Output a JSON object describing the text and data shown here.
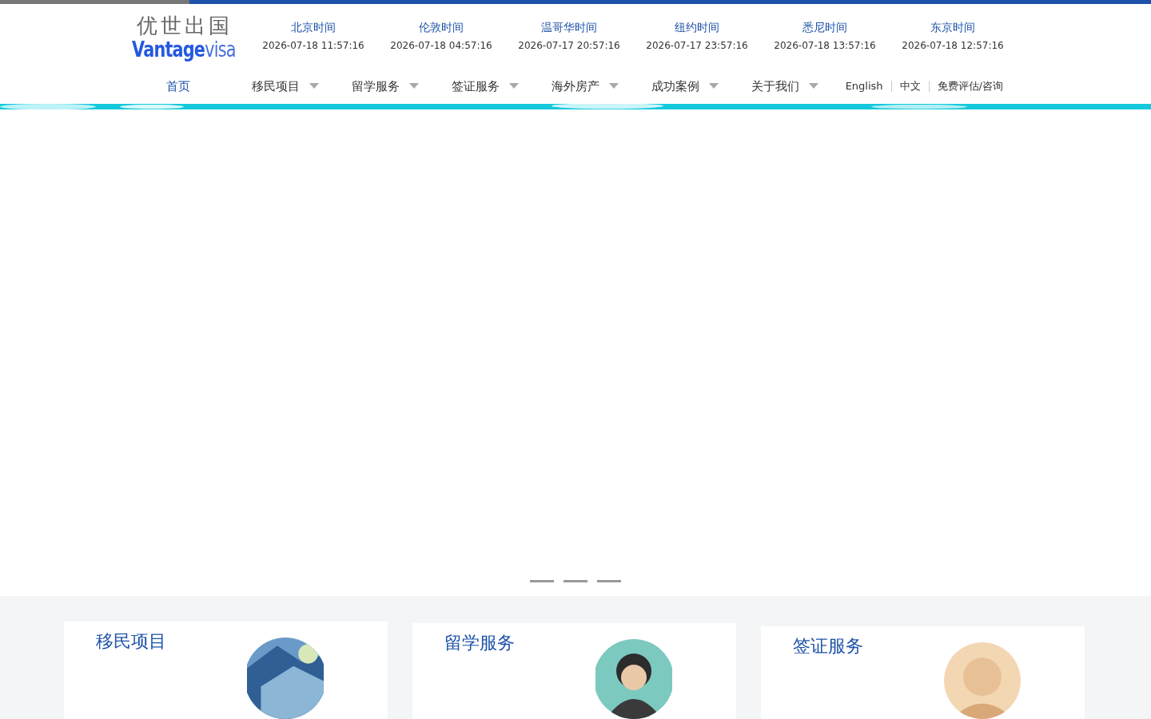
{
  "logo": {
    "chinese": "优世出国",
    "brand_main": "Vantage",
    "brand_tail": "visa"
  },
  "clocks": [
    {
      "city": "北京时间",
      "time": "2026-07-18 11:57:16"
    },
    {
      "city": "伦敦时间",
      "time": "2026-07-18 04:57:16"
    },
    {
      "city": "温哥华时间",
      "time": "2026-07-17 20:57:16"
    },
    {
      "city": "纽约时间",
      "time": "2026-07-17 23:57:16"
    },
    {
      "city": "悉尼时间",
      "time": "2026-07-18 13:57:16"
    },
    {
      "city": "东京时间",
      "time": "2026-07-18 12:57:16"
    }
  ],
  "nav": [
    {
      "label": "首页",
      "selected": true,
      "dropdown": false
    },
    {
      "label": "移民项目",
      "selected": false,
      "dropdown": true
    },
    {
      "label": "留学服务",
      "selected": false,
      "dropdown": true
    },
    {
      "label": "签证服务",
      "selected": false,
      "dropdown": true
    },
    {
      "label": "海外房产",
      "selected": false,
      "dropdown": true
    },
    {
      "label": "成功案例",
      "selected": false,
      "dropdown": true
    },
    {
      "label": "关于我们",
      "selected": false,
      "dropdown": true
    }
  ],
  "links": [
    "English",
    "中文",
    "免费评估/咨询"
  ],
  "cards": [
    {
      "title": "移民项目",
      "kind": "picture"
    },
    {
      "title": "留学服务",
      "kind": "picture"
    },
    {
      "title": "签证服务",
      "kind": "picture"
    }
  ]
}
